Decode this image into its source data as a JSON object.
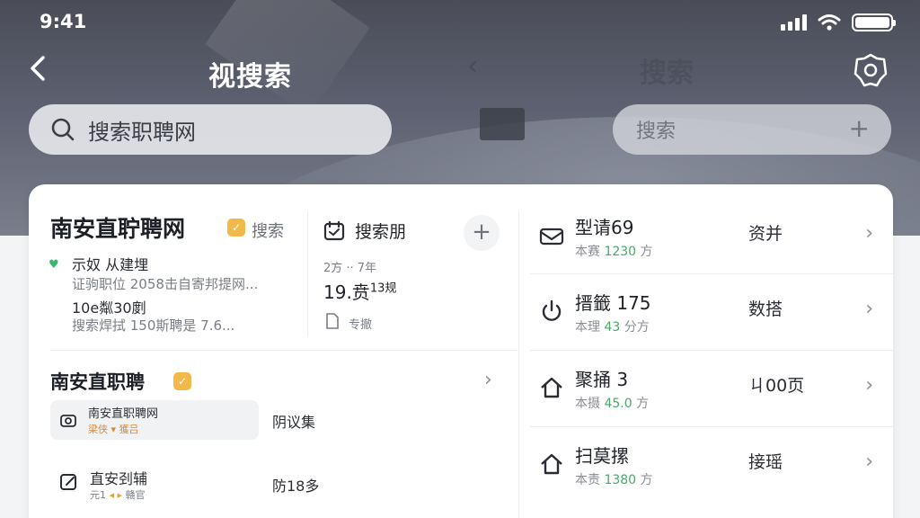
{
  "status": {
    "time": "9:41"
  },
  "nav": {
    "title": "视搜索",
    "ghost_title": "搜索"
  },
  "search": {
    "main_label": "搜索职聘网",
    "right_label": "搜索"
  },
  "card_left": {
    "title": "南安直聍聘网",
    "title_tag": "搜索",
    "lines": [
      "示奴 从建埋",
      "证驹职位 2058击自寄邦提网...",
      "10e粼30剫",
      "搜索焊拭 150斯聘是 7.6..."
    ],
    "mid_title": "搜索朋",
    "mid_meta": "2方 ·· 7年",
    "mid_value": "19.贲",
    "mid_value_sup": "13规",
    "mid_link": "专撤",
    "section_title": "南安直职聘",
    "item1_title": "南安直职聘网",
    "item1_sub_a": "梁侠",
    "item1_sub_b": "獲吕",
    "item1_right": "阴议集",
    "item2_title": "直安刭辅",
    "item2_sub_a": "元1",
    "item2_sub_b": "赣官",
    "item2_right": "防18多"
  },
  "card_right": {
    "rows": [
      {
        "title": "型请69",
        "sub_a": "本赛",
        "sub_b": "1230",
        "sub_c": "方",
        "value": "资并"
      },
      {
        "title": "搢籤 175",
        "sub_a": "本理",
        "sub_b": "43",
        "sub_c": "分方",
        "value": "数搭"
      },
      {
        "title": "聚捅 3",
        "sub_a": "本摄",
        "sub_b": "45.0",
        "sub_c": "方",
        "value": "ㄐ00页"
      },
      {
        "title": "扫莫摞",
        "sub_a": "本责",
        "sub_b": "1380",
        "sub_c": "方",
        "value": "接瑶"
      }
    ]
  }
}
